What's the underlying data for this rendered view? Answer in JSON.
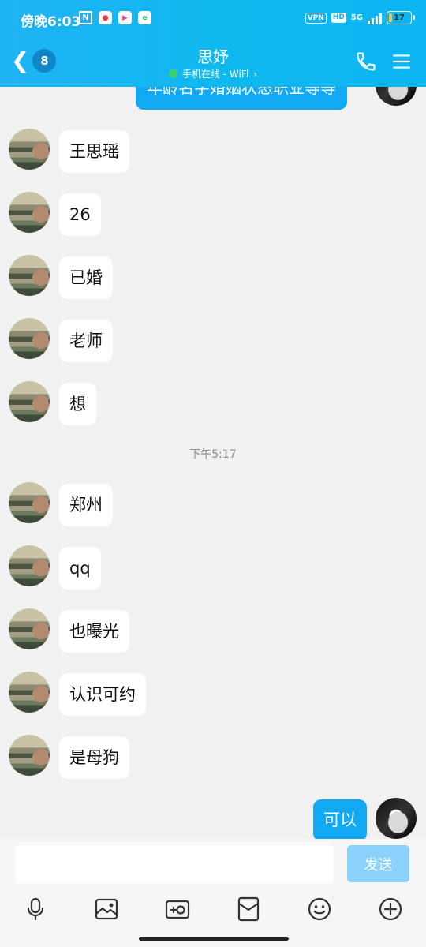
{
  "status_bar": {
    "time": "傍晚6:03",
    "apps": [
      "nfc-icon",
      "red-app-icon",
      "play-app-icon",
      "green-app-icon"
    ],
    "vpn": "VPN",
    "hd": "HD",
    "network": "5G",
    "battery": "17",
    "battery_level": 0.17
  },
  "nav": {
    "unread_count": "8",
    "title": "思妤",
    "status": "手机在线 - WiFi",
    "status_chevron": "›"
  },
  "messages": {
    "self_partial": "年龄名字婚姻状态职业等等",
    "m1": "王思瑶",
    "m2": "26",
    "m3": "已婚",
    "m4": "老师",
    "m5": "想",
    "timestamp": "下午5:17",
    "m6": "郑州",
    "m7": "qq",
    "m8": "也曝光",
    "m9": "认识可约",
    "m10": "是母狗",
    "self_last": "可以"
  },
  "input": {
    "placeholder": "",
    "send_label": "发送"
  },
  "toolbar": [
    "microphone-icon",
    "photo-icon",
    "camera-icon",
    "red-packet-icon",
    "emoji-icon",
    "plus-icon"
  ],
  "colors": {
    "header": "#10b8f0",
    "self_bubble": "#12a9f4",
    "send_button": "#8bd2fb",
    "background": "#f1f1f1"
  }
}
